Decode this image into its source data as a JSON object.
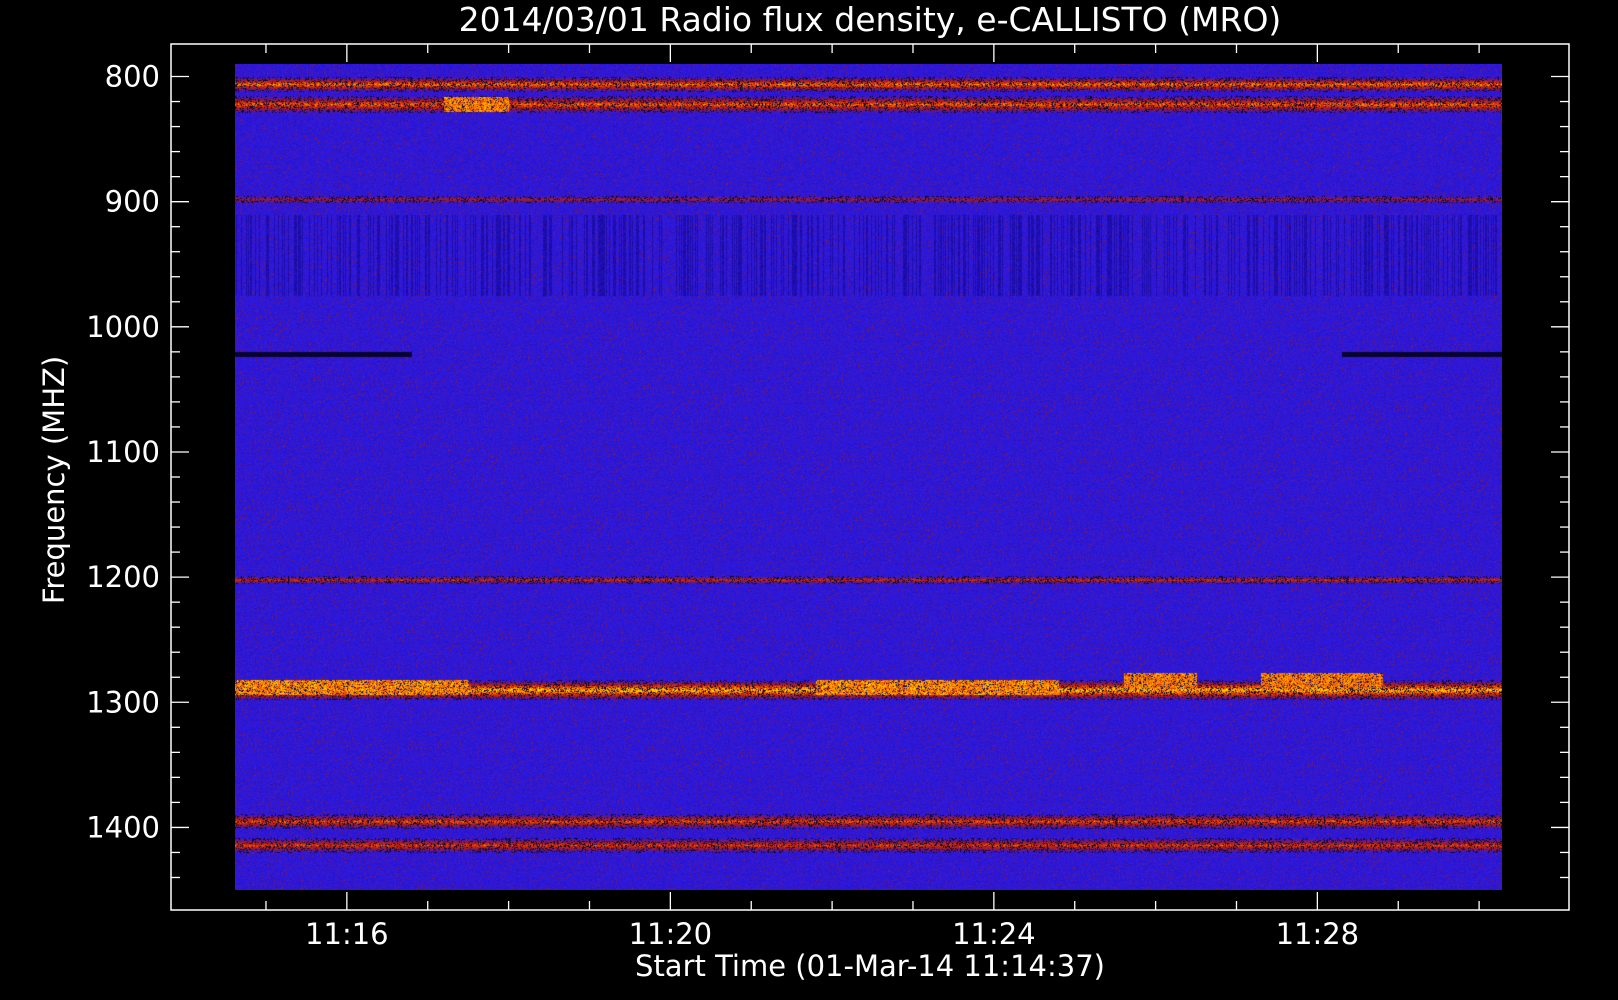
{
  "chart_data": {
    "type": "heatmap",
    "title": "2014/03/01  Radio flux density, e-CALLISTO (MRO)",
    "xlabel": "Start Time (01-Mar-14 11:14:37)",
    "ylabel": "Frequency (MHZ)",
    "x_ticks": [
      "11:16",
      "11:20",
      "11:24",
      "11:28"
    ],
    "x_tick_minutes": [
      16,
      20,
      24,
      28
    ],
    "x_range_minutes": [
      14.617,
      30.283
    ],
    "y_ticks": [
      800,
      900,
      1000,
      1100,
      1200,
      1300,
      1400
    ],
    "y_range": [
      790,
      1450
    ],
    "y_inverted": true,
    "grid": false,
    "colors": {
      "background": "#000000",
      "frame": "#ffffff",
      "text": "#ffffff",
      "colormap": [
        "#000000",
        "#1a0a9a",
        "#2a19e6",
        "#7a1a60",
        "#cc2200",
        "#ff7a00",
        "#ffe000"
      ]
    },
    "bands": [
      {
        "center": 806,
        "width": 6,
        "intensity": 0.75
      },
      {
        "center": 822,
        "width": 7,
        "intensity": 0.7
      },
      {
        "center": 898,
        "width": 3,
        "intensity": 0.4
      },
      {
        "center": 1022,
        "width": 2,
        "intensity": -0.9
      },
      {
        "center": 1202,
        "width": 3,
        "intensity": 0.55
      },
      {
        "center": 1290,
        "width": 8,
        "intensity": 0.95
      },
      {
        "center": 1395,
        "width": 6,
        "intensity": 0.65
      },
      {
        "center": 1414,
        "width": 6,
        "intensity": 0.6
      }
    ],
    "bursts": [
      {
        "t_start": 14.617,
        "t_end": 17.5,
        "freq": 1288,
        "intensity": 1.0
      },
      {
        "t_start": 21.8,
        "t_end": 24.8,
        "freq": 1288,
        "intensity": 1.0
      },
      {
        "t_start": 25.6,
        "t_end": 26.5,
        "freq": 1282,
        "intensity": 0.9
      },
      {
        "t_start": 27.3,
        "t_end": 28.8,
        "freq": 1282,
        "intensity": 0.9
      },
      {
        "t_start": 17.2,
        "t_end": 18.0,
        "freq": 822,
        "intensity": 0.9
      }
    ],
    "dark_striations": {
      "f_start": 910,
      "f_end": 975
    }
  }
}
